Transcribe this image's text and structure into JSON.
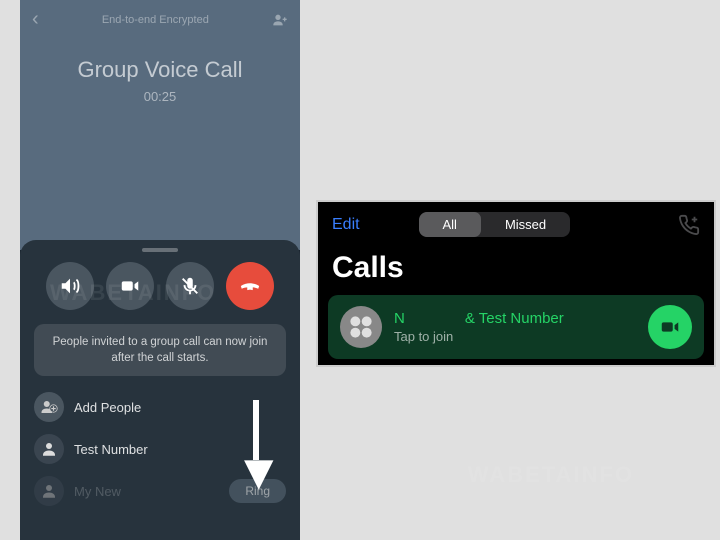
{
  "left": {
    "topbar": {
      "back": "‹",
      "encrypted_label": "End-to-end Encrypted",
      "title": "Group Voice Call",
      "timer": "00:25"
    },
    "info_text": "People invited to a group call can now join after the call starts.",
    "people": [
      {
        "name": "Add People"
      },
      {
        "name": "Test Number"
      },
      {
        "name": "My New"
      }
    ],
    "ring_label": "Ring"
  },
  "right": {
    "edit_label": "Edit",
    "segments": {
      "all": "All",
      "missed": "Missed"
    },
    "heading": "Calls",
    "card": {
      "name1": "N",
      "name2": "& Test Number",
      "subtitle": "Tap to join"
    }
  },
  "watermark": "WABETAINFO"
}
